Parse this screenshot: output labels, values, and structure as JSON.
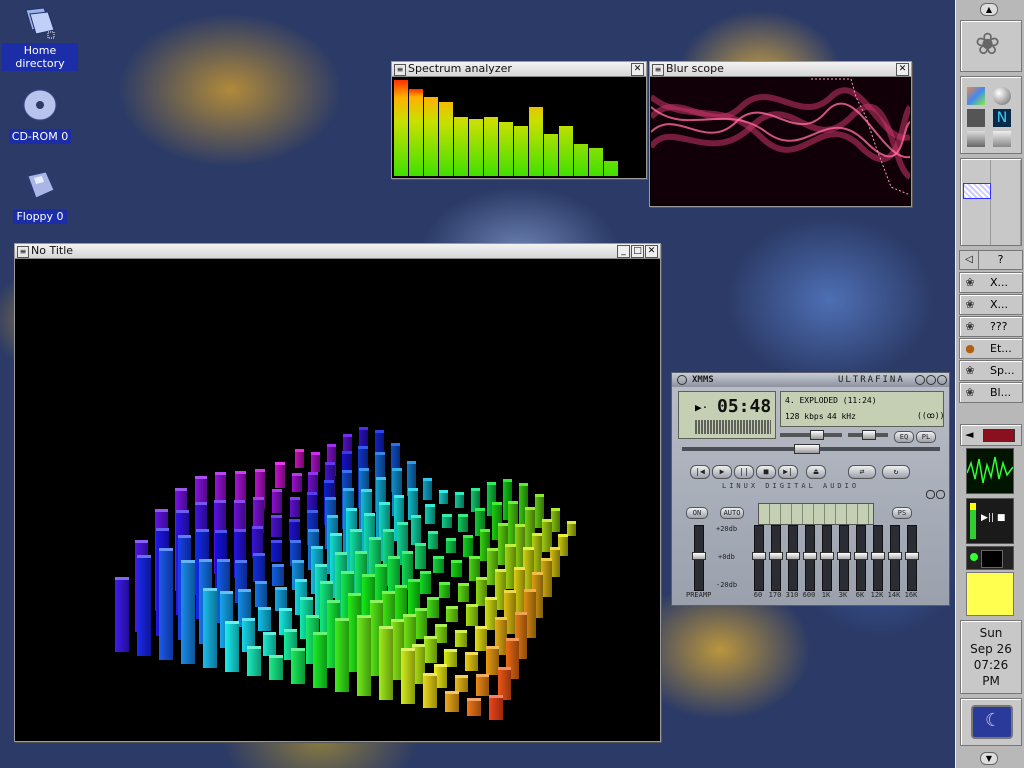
{
  "desktop": {
    "icons": [
      {
        "label": "Home directory",
        "icon": "home-directory-icon"
      },
      {
        "label": "CD-ROM 0",
        "icon": "cdrom-icon"
      },
      {
        "label": "Floppy 0",
        "icon": "floppy-icon"
      }
    ]
  },
  "windows": {
    "spectrum": {
      "title": "Spectrum analyzer",
      "close": "✕"
    },
    "blur": {
      "title": "Blur scope",
      "close": "✕"
    },
    "main": {
      "title": "No Title",
      "minimize": "_",
      "maximize": "□",
      "close": "✕"
    }
  },
  "xmms": {
    "title": "XMMS",
    "skin_name": "ULTRAFINA",
    "time": "05:48",
    "track": "4. EXPLODED (11:24)",
    "bitrate": "128 kbps",
    "samplerate": "44 kHz",
    "eq_label": "EQ",
    "pl_label": "PL",
    "controls": {
      "prev": "|◀",
      "play": "▶",
      "pause": "||",
      "stop": "■",
      "next": "▶|",
      "eject": "⏏",
      "shuffle": "⇄",
      "repeat": "↻"
    },
    "eq_banner": "LINUX DIGITAL AUDIO",
    "eq_on": "ON",
    "eq_auto": "AUTO",
    "presets": "PS",
    "db_labels": [
      "+20db",
      "+0db",
      "-20db"
    ],
    "preamp_label": "PREAMP",
    "eq_bands": [
      "60",
      "170",
      "310",
      "600",
      "1K",
      "3K",
      "6K",
      "12K",
      "14K",
      "16K"
    ]
  },
  "panel": {
    "help_label": "?",
    "tasks": [
      {
        "label": "X..."
      },
      {
        "label": "X..."
      },
      {
        "label": "???"
      },
      {
        "label": "Et..."
      },
      {
        "label": "Sp..."
      },
      {
        "label": "Bl..."
      }
    ],
    "clock": {
      "day": "Sun",
      "date": "Sep 26",
      "time": "07:26",
      "ampm": "PM"
    }
  },
  "colors": {
    "desktop_bg": "#2b3a66",
    "icon_label_bg": "#1c2da8",
    "spectrum_top": "#ff3000",
    "spectrum_bottom": "#40e000",
    "blur_scope": "#e0407a",
    "xmms_body": "#aeb3bd",
    "lcd": "#c4cfb4",
    "panel": "#b8b8b8"
  },
  "spectrum_levels": [
    0.97,
    0.88,
    0.8,
    0.75,
    0.6,
    0.58,
    0.6,
    0.55,
    0.5,
    0.7,
    0.42,
    0.5,
    0.32,
    0.28,
    0.15
  ]
}
